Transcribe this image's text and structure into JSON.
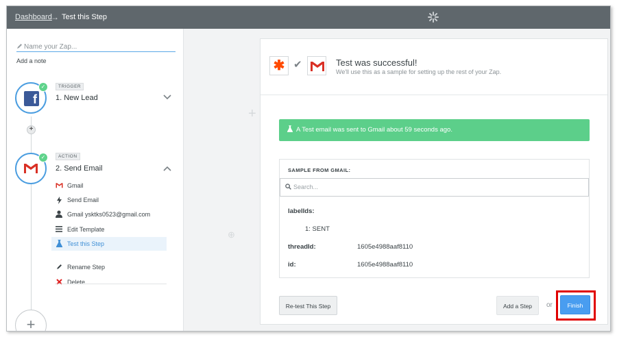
{
  "topbar": {
    "breadcrumb_link": "Dashboard",
    "breadcrumb_arrow": "→",
    "breadcrumb_current": "Test this Step"
  },
  "sidebar": {
    "zap_name_placeholder": "Name your Zap...",
    "add_note": "Add a note",
    "trigger": {
      "tag": "TRIGGER",
      "title": "1. New Lead",
      "app": "facebook"
    },
    "action": {
      "tag": "ACTION",
      "title": "2. Send Email",
      "app": "gmail"
    },
    "action_items": [
      {
        "icon": "gmail-icon",
        "label": "Gmail"
      },
      {
        "icon": "bolt-icon",
        "label": "Send Email"
      },
      {
        "icon": "user-icon",
        "label": "Gmail ysktks0523@gmail.com"
      },
      {
        "icon": "list-icon",
        "label": "Edit Template"
      },
      {
        "icon": "flask-icon",
        "label": "Test this Step"
      }
    ],
    "rename": "Rename Step",
    "delete": "Delete"
  },
  "card": {
    "title": "Test was successful!",
    "subtitle": "We'll use this as a sample for setting up the rest of your Zap.",
    "alert": "A Test email was sent to Gmail about 59 seconds ago.",
    "sample_header": "SAMPLE FROM GMAIL:",
    "search_placeholder": "Search...",
    "fields": {
      "labelIds_key": "labelIds:",
      "labelIds_item": "1: SENT",
      "threadId_key": "threadId:",
      "threadId_val": "1605e4988aaf8110",
      "id_key": "id:",
      "id_val": "1605e4988aaf8110"
    },
    "retest_label": "Re-test This Step",
    "add_step_label": "Add a Step",
    "or_label": "or",
    "finish_label": "Finish"
  },
  "colors": {
    "accent": "#499df0",
    "success": "#5ccf8a",
    "topbar": "#5f676c",
    "highlight": "#e00000"
  }
}
